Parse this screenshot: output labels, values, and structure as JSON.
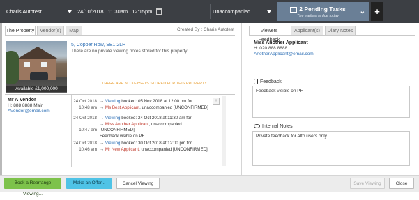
{
  "topbar": {
    "user": "Charis Autotest",
    "date": "24/10/2018",
    "time_start": "11:30am",
    "time_end": "12:15pm",
    "status": "Unaccompanied",
    "pending_title": "2 Pending Tasks",
    "pending_sub": "The earliest is due today",
    "add_symbol": "+"
  },
  "left_tabs": [
    "The Property",
    "Vendor(s)",
    "Map"
  ],
  "created_by": "Created By : Charis Autotest",
  "property": {
    "address": "5, Copper Row, SE1 2LH",
    "no_notes": "There are no private viewing notes stored for this property.",
    "price": "Available £1,000,000",
    "no_keysets": "THERE ARE NO KEYSETS STORED FOR THIS PROPERTY."
  },
  "vendor": {
    "name": "Mr A Vendor",
    "phone": "H: 888 8888 Main",
    "email": "AVendor@email.com"
  },
  "history": [
    {
      "date": "24 Oct 2018",
      "time": "10:48 am",
      "link": "Viewing",
      "text": " booked: 05 Nov 2018 at 12:00 pm for",
      "applicant": "Ms Best Applicant",
      "rest": ", unaccompanied [UNCONFIRMED]",
      "note": ""
    },
    {
      "date": "24 Oct 2018",
      "time": "10:47 am",
      "link": "Viewing",
      "text": " booked: 24 Oct 2018 at 11:30 am for",
      "applicant": "Miss Another Applicant",
      "rest": ", unaccompanied",
      "rest2": "[UNCONFIRMED]",
      "note": "Feedback visible on PF"
    },
    {
      "date": "24 Oct 2018",
      "time": "10:46 am",
      "link": "Viewing",
      "text": " booked: 30 Oct 2018 at 12:00 pm for",
      "applicant": "Mr New Applicant",
      "rest": ", unaccompanied [UNCONFIRMED]",
      "note": ""
    }
  ],
  "right_tabs": [
    "Viewers Feedback",
    "Applicant(s)",
    "Diary Notes"
  ],
  "applicant": {
    "name": "Miss Another Applicant",
    "phone": "H: 020 888 8888",
    "email": "AnotherApplicant@email.com"
  },
  "feedback": {
    "label": "Feedback",
    "text": "Feedback visible on PF"
  },
  "internal": {
    "label": "Internal Notes",
    "text": "Private feedback for Alto users only"
  },
  "buttons": {
    "rearrange": "Book a Rearrange Viewing...",
    "offer": "Make an Offer...",
    "cancel": "Cancel Viewing",
    "save": "Save Viewing",
    "close": "Close"
  },
  "colors": {
    "topbar": "#3c3f44",
    "pending": "#6a7f96",
    "green": "#7dc24b",
    "cyan": "#4fc3e6",
    "link": "#2d6fb5",
    "red": "#c0392b"
  }
}
